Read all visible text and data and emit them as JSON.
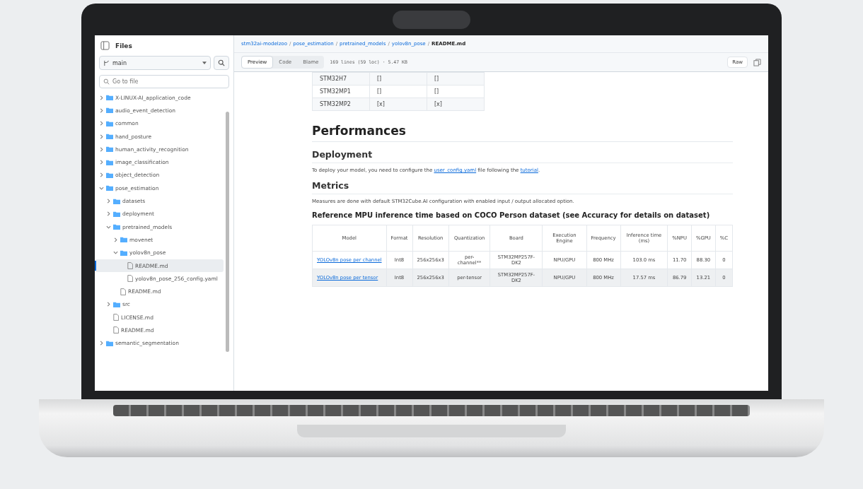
{
  "sidebar": {
    "title": "Files",
    "branch": "main",
    "search": {
      "placeholder": "Go to file"
    },
    "tree": [
      {
        "kind": "folder",
        "name": "X-LINUX-AI_application_code",
        "expanded": false,
        "selected": false
      },
      {
        "kind": "folder",
        "name": "audio_event_detection",
        "expanded": false,
        "selected": false
      },
      {
        "kind": "folder",
        "name": "common",
        "expanded": false,
        "selected": false
      },
      {
        "kind": "folder",
        "name": "hand_posture",
        "expanded": false,
        "selected": false
      },
      {
        "kind": "folder",
        "name": "human_activity_recognition",
        "expanded": false,
        "selected": false
      },
      {
        "kind": "folder",
        "name": "image_classification",
        "expanded": false,
        "selected": false
      },
      {
        "kind": "folder",
        "name": "object_detection",
        "expanded": false,
        "selected": false
      },
      {
        "kind": "folder",
        "name": "pose_estimation",
        "expanded": true,
        "selected": false,
        "children": [
          {
            "kind": "folder",
            "name": "datasets",
            "expanded": false,
            "selected": false
          },
          {
            "kind": "folder",
            "name": "deployment",
            "expanded": false,
            "selected": false
          },
          {
            "kind": "folder",
            "name": "pretrained_models",
            "expanded": true,
            "selected": false,
            "children": [
              {
                "kind": "folder",
                "name": "movenet",
                "expanded": false,
                "selected": false
              },
              {
                "kind": "folder",
                "name": "yolov8n_pose",
                "expanded": true,
                "selected": false,
                "children": [
                  {
                    "kind": "file",
                    "name": "README.md",
                    "selected": true
                  },
                  {
                    "kind": "file",
                    "name": "yolov8n_pose_256_config.yaml",
                    "selected": false
                  }
                ]
              },
              {
                "kind": "file",
                "name": "README.md",
                "selected": false
              }
            ]
          },
          {
            "kind": "folder",
            "name": "src",
            "expanded": false,
            "selected": false
          },
          {
            "kind": "file",
            "name": "LICENSE.md",
            "selected": false
          },
          {
            "kind": "file",
            "name": "README.md",
            "selected": false
          }
        ]
      },
      {
        "kind": "folder",
        "name": "semantic_segmentation",
        "expanded": false,
        "selected": false
      }
    ]
  },
  "breadcrumb_separator": "/",
  "breadcrumb": [
    "stm32ai-modelzoo",
    "pose_estimation",
    "pretrained_models",
    "yolov8n_pose",
    "README.md"
  ],
  "view_tabs": [
    {
      "label": "Preview",
      "selected": true
    },
    {
      "label": "Code",
      "selected": false
    },
    {
      "label": "Blame",
      "selected": false
    }
  ],
  "file_info": "169 lines (59 loc) · 5.47 KB",
  "raw_button": "Raw",
  "support_table": [
    [
      "STM32H7",
      "[]",
      "[]"
    ],
    [
      "STM32MP1",
      "[]",
      "[]"
    ],
    [
      "STM32MP2",
      "[x]",
      "[x]"
    ]
  ],
  "content": [
    {
      "kind": "h1",
      "text": "Performances"
    },
    {
      "kind": "h2",
      "text": "Deployment"
    },
    {
      "kind": "p",
      "parts": [
        {
          "text": "To deploy your model, you need to configure the "
        },
        {
          "text": "user_config.yaml",
          "link": true
        },
        {
          "text": " file following the "
        },
        {
          "text": "tutorial",
          "link": true
        },
        {
          "text": "."
        }
      ]
    },
    {
      "kind": "h2",
      "text": "Metrics"
    },
    {
      "kind": "p",
      "parts": [
        {
          "text": "Measures are done with default STM32Cube.AI configuration with enabled input / output allocated option."
        }
      ]
    },
    {
      "kind": "h3",
      "text": "Reference MPU inference time based on COCO Person dataset (see Accuracy for details on dataset)"
    }
  ],
  "perf_table": {
    "columns": [
      "Model",
      "Format",
      "Resolution",
      "Quantization",
      "Board",
      "Execution Engine",
      "Frequency",
      "Inference time (ms)",
      "%NPU",
      "%GPU",
      "%C"
    ],
    "rows": [
      [
        "YOLOv8n pose per channel",
        "Int8",
        "256x256x3",
        "per-channel**",
        "STM32MP257F-DK2",
        "NPU/GPU",
        "800 MHz",
        "103.0 ms",
        "11.70",
        "88.30",
        "0"
      ],
      [
        "YOLOv8n pose per tensor",
        "Int8",
        "256x256x3",
        "per-tensor",
        "STM32MP257F-DK2",
        "NPU/GPU",
        "800 MHz",
        "17.57 ms",
        "86.79",
        "13.21",
        "0"
      ]
    ]
  }
}
